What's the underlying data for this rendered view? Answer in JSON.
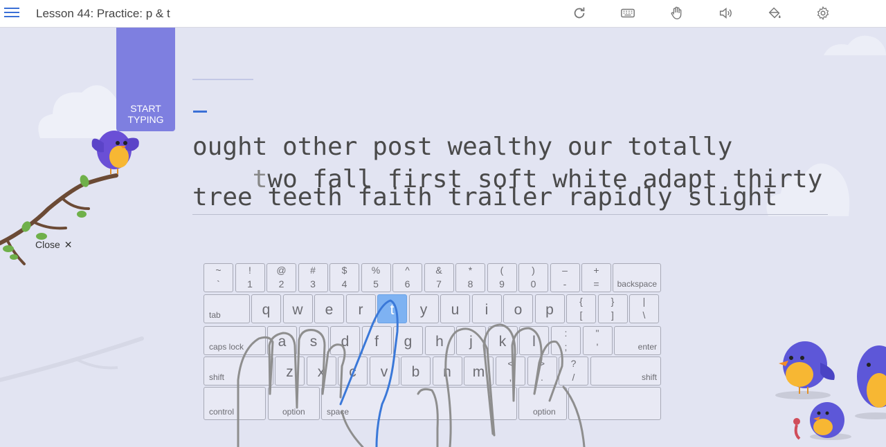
{
  "header": {
    "lesson_title": "Lesson 44: Practice: p & t",
    "tools": [
      "restart-icon",
      "keyboard-icon",
      "hand-icon",
      "sound-icon",
      "paint-bucket-icon",
      "gear-icon"
    ]
  },
  "start_tab": {
    "line1": "START",
    "line2": "TYPING"
  },
  "typing": {
    "current_char": "t",
    "line1_rest": "wo fall first soft white adapt thirty",
    "line2": "ought other post wealthy our totally",
    "line3": "tree teeth faith trailer rapidly slight"
  },
  "close": {
    "label": "Close",
    "icon": "✕"
  },
  "keyboard": {
    "row1": [
      {
        "top": "~",
        "bot": "`"
      },
      {
        "top": "!",
        "bot": "1"
      },
      {
        "top": "@",
        "bot": "2"
      },
      {
        "top": "#",
        "bot": "3"
      },
      {
        "top": "$",
        "bot": "4"
      },
      {
        "top": "%",
        "bot": "5"
      },
      {
        "top": "^",
        "bot": "6"
      },
      {
        "top": "&",
        "bot": "7"
      },
      {
        "top": "*",
        "bot": "8"
      },
      {
        "top": "(",
        "bot": "9"
      },
      {
        "top": ")",
        "bot": "0"
      },
      {
        "top": "–",
        "bot": "-"
      },
      {
        "top": "+",
        "bot": "="
      }
    ],
    "backspace": "backspace",
    "tab": "tab",
    "row2": [
      "q",
      "w",
      "e",
      "r",
      "t",
      "y",
      "u",
      "i",
      "o",
      "p"
    ],
    "row2_sym": [
      {
        "top": "{",
        "bot": "["
      },
      {
        "top": "}",
        "bot": "]"
      },
      {
        "top": "|",
        "bot": "\\"
      }
    ],
    "caps": "caps lock",
    "row3": [
      "a",
      "s",
      "d",
      "f",
      "g",
      "h",
      "j",
      "k",
      "l"
    ],
    "row3_sym": [
      {
        "top": ":",
        "bot": ";"
      },
      {
        "top": "\"",
        "bot": "'"
      }
    ],
    "enter": "enter",
    "shift_l": "shift",
    "row4": [
      "z",
      "x",
      "c",
      "v",
      "b",
      "n",
      "m"
    ],
    "row4_sym": [
      {
        "top": "<",
        "bot": ","
      },
      {
        "top": ">",
        "bot": "."
      },
      {
        "top": "?",
        "bot": "/"
      }
    ],
    "shift_r": "shift",
    "control": "control",
    "option_l": "option",
    "space": "space",
    "option_r": "option",
    "highlight_key": "t"
  },
  "colors": {
    "accent": "#3a6fd6",
    "tab": "#7e7fe0",
    "highlight": "#7eb2f2",
    "background": "#e2e4f2"
  }
}
